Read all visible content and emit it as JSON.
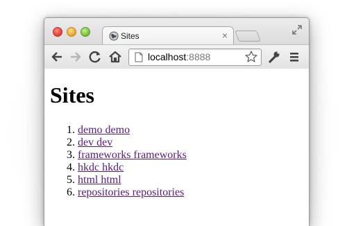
{
  "tab": {
    "title": "Sites",
    "close": "×"
  },
  "omnibox": {
    "host": "localhost",
    "port": ":8888"
  },
  "page": {
    "heading": "Sites",
    "links": [
      {
        "num": "1.",
        "text": "demo demo"
      },
      {
        "num": "2.",
        "text": "dev dev"
      },
      {
        "num": "3.",
        "text": "frameworks frameworks"
      },
      {
        "num": "4.",
        "text": "hkdc hkdc"
      },
      {
        "num": "5.",
        "text": "html html"
      },
      {
        "num": "6.",
        "text": "repositories repositories"
      }
    ]
  },
  "icons": {
    "tab_favicon": "globe-icon",
    "back": "back-arrow-icon",
    "forward": "forward-arrow-icon",
    "reload": "reload-icon",
    "home": "home-icon",
    "page": "page-icon",
    "bookmark": "star-icon",
    "wrench": "wrench-icon",
    "menu": "hamburger-menu-icon",
    "fullscreen": "fullscreen-icon"
  },
  "colors": {
    "link": "#551a8b"
  }
}
